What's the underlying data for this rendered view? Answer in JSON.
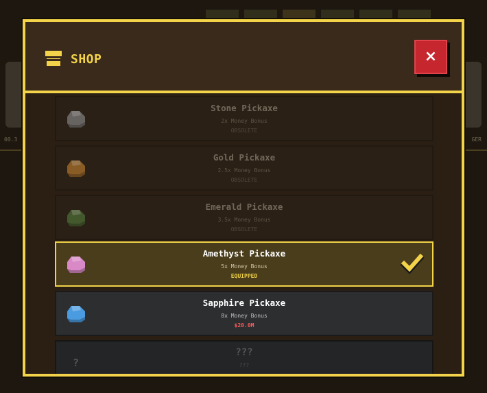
{
  "background": {
    "left_label": "00.3",
    "right_label": "GER"
  },
  "shop": {
    "title": "SHOP",
    "close_label": "×",
    "accent": "#f2d349",
    "close_color": "#c6262e"
  },
  "items": [
    {
      "name": "Stone Pickaxe",
      "bonus": "2x Money Bonus",
      "status": "OBSOLETE",
      "state": "obsolete",
      "icon": "stone-gem-icon",
      "color": "#7a7a7a"
    },
    {
      "name": "Gold Pickaxe",
      "bonus": "2.5x Money Bonus",
      "status": "OBSOLETE",
      "state": "obsolete",
      "icon": "gold-gem-icon",
      "color": "#a9712b"
    },
    {
      "name": "Emerald Pickaxe",
      "bonus": "3.5x Money Bonus",
      "status": "OBSOLETE",
      "state": "obsolete",
      "icon": "emerald-gem-icon",
      "color": "#4c6b34"
    },
    {
      "name": "Amethyst Pickaxe",
      "bonus": "5x Money Bonus",
      "status": "EQUIPPED",
      "state": "equipped",
      "icon": "amethyst-gem-icon",
      "color": "#d889c6"
    },
    {
      "name": "Sapphire Pickaxe",
      "bonus": "8x Money Bonus",
      "status": "$20.0M",
      "state": "buy",
      "icon": "sapphire-gem-icon",
      "color": "#4a9be0"
    },
    {
      "name": "???",
      "bonus": "???",
      "status": "",
      "state": "locked",
      "icon": "question-icon",
      "icon_label": "?"
    }
  ]
}
